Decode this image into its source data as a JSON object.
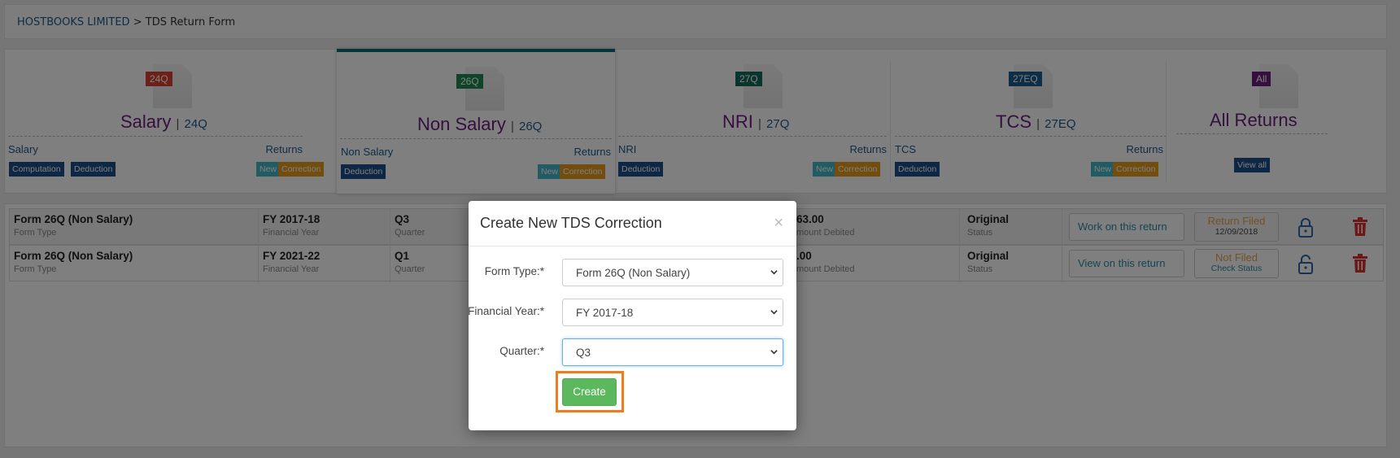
{
  "breadcrumb": {
    "company": "HOSTBOOKS LIMITED",
    "separator": ">",
    "page": "TDS Return Form"
  },
  "cards": [
    {
      "badge": "24Q",
      "badge_color": "#d9412e",
      "title": "Salary",
      "code": "24Q",
      "left_label": "Salary",
      "right_label": "Returns",
      "tags": [
        "Computation",
        "Deduction"
      ],
      "right_tags": [
        "New",
        "Correction"
      ]
    },
    {
      "badge": "26Q",
      "badge_color": "#1f8a4c",
      "title": "Non Salary",
      "code": "26Q",
      "left_label": "Non Salary",
      "right_label": "Returns",
      "tags": [
        "Deduction"
      ],
      "right_tags": [
        "New",
        "Correction"
      ]
    },
    {
      "badge": "27Q",
      "badge_color": "#146b5a",
      "title": "NRI",
      "code": "27Q",
      "left_label": "NRI",
      "right_label": "Returns",
      "tags": [
        "Deduction"
      ],
      "right_tags": [
        "New",
        "Correction"
      ]
    },
    {
      "badge": "27EQ",
      "badge_color": "#1c5a8c",
      "title": "TCS",
      "code": "27EQ",
      "left_label": "TCS",
      "right_label": "Returns",
      "tags": [
        "Deduction"
      ],
      "right_tags": [
        "New",
        "Correction"
      ]
    },
    {
      "badge": "All",
      "badge_color": "#6b1f7c",
      "title": "All Returns",
      "view_all": "View all"
    }
  ],
  "rows": [
    {
      "form": "Form 26Q (Non Salary)",
      "form_sub": "Form Type",
      "fy": "FY 2017-18",
      "fy_sub": "Financial Year",
      "q": "Q3",
      "q_sub": "Quarter",
      "amt": "63.00",
      "amt_sub": "mount Debited",
      "status": "Original",
      "status_sub": "Status",
      "action": "Work on this return",
      "ret1": "Return Filed",
      "ret2": "12/09/2018"
    },
    {
      "form": "Form 26Q (Non Salary)",
      "form_sub": "Form Type",
      "fy": "FY 2021-22",
      "fy_sub": "Financial Year",
      "q": "Q1",
      "q_sub": "Quarter",
      "amt": ".00",
      "amt_sub": "mount Debited",
      "status": "Original",
      "status_sub": "Status",
      "action": "View on this return",
      "ret1": "Not Filed",
      "ret2": "Check Status"
    }
  ],
  "modal": {
    "title": "Create New TDS Correction",
    "close": "×",
    "form_type_label": "Form Type:*",
    "form_type_value": "Form 26Q (Non Salary)",
    "fy_label": "Financial Year:*",
    "fy_value": "FY 2017-18",
    "quarter_label": "Quarter:*",
    "quarter_value": "Q3",
    "create": "Create"
  },
  "colors": {
    "accent": "#6b1f7c",
    "link": "#1c5a8c",
    "create": "#5cb85c",
    "highlight": "#f07c1b",
    "trash": "#d9302c"
  },
  "icons": [
    "lock-icon",
    "trash-icon",
    "chevron-down-icon",
    "close-icon",
    "document-icon"
  ]
}
